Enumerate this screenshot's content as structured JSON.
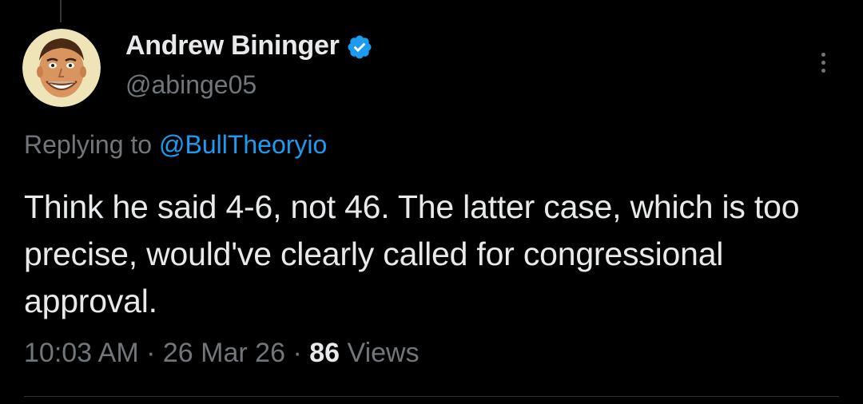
{
  "author": {
    "display_name": "Andrew Bininger",
    "handle": "@abinge05",
    "verified": true
  },
  "reply": {
    "prefix": "Replying to",
    "mention": "@BullTheoryio"
  },
  "tweet": {
    "text": "Think he said 4-6, not 46. The latter case, which is too precise, would've clearly called for congressional approval."
  },
  "meta": {
    "time": "10:03 AM",
    "separator": "·",
    "date": "26 Mar 26",
    "views_count": "86",
    "views_label": "Views"
  },
  "colors": {
    "background": "#000000",
    "primary_text": "#e7e9ea",
    "secondary_text": "#71767b",
    "accent": "#1d9bf0"
  },
  "icons": {
    "verified": "verified-badge-icon",
    "more": "more-options-icon"
  }
}
